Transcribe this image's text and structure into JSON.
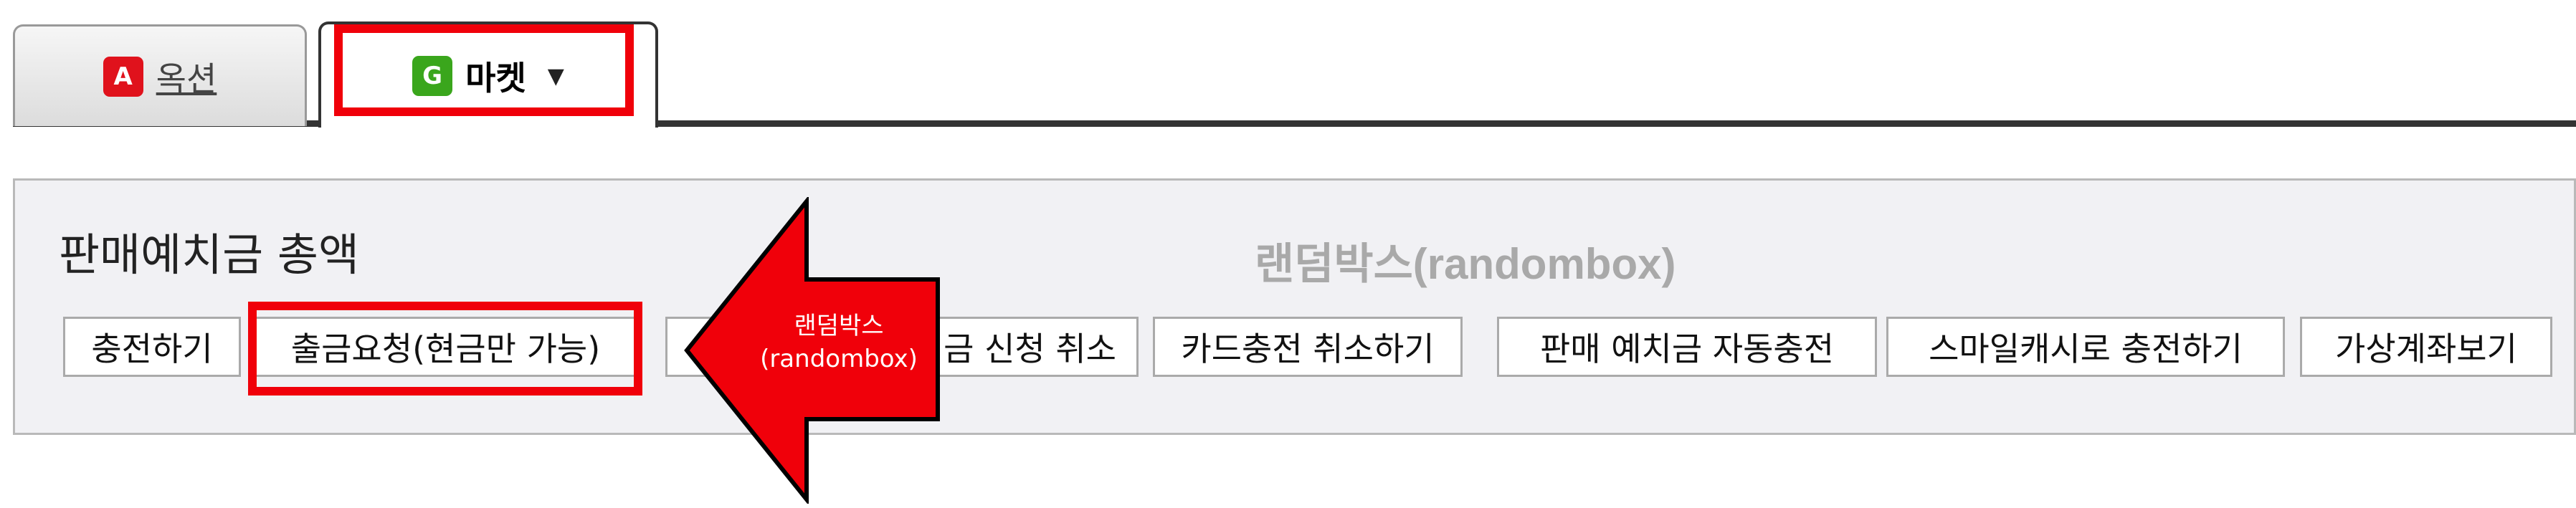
{
  "tabs": [
    {
      "badge": "A",
      "label": "옥션",
      "active": false
    },
    {
      "badge": "G",
      "label": "마켓",
      "active": true
    }
  ],
  "panel": {
    "title": "판매예치금 총액",
    "watermark": "랜덤박스(randombox)"
  },
  "buttons": [
    "충전하기",
    "출금요청(현금만 가능)",
    "금 신청 취소",
    "카드충전 취소하기",
    "판매 예치금 자동충전",
    "스마일캐시로 충전하기",
    "가상계좌보기"
  ],
  "arrow": {
    "line1": "랜덤박스",
    "line2": "(randombox)"
  },
  "colors": {
    "highlight": "#f0000a",
    "auction_badge": "#e0121c",
    "market_badge": "#3aa61c",
    "panel_bg": "#f1f1f4"
  }
}
